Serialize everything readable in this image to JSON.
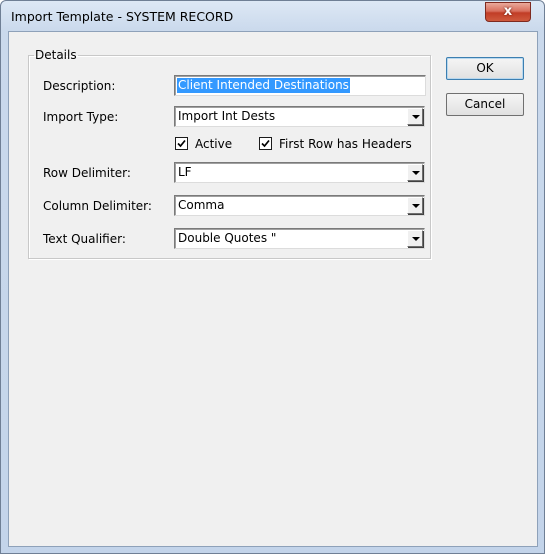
{
  "window": {
    "title": "Import Template - SYSTEM RECORD",
    "close_glyph": "x"
  },
  "group": {
    "legend": "Details"
  },
  "fields": {
    "description": {
      "label": "Description:",
      "value": "Client Intended Destinations"
    },
    "import_type": {
      "label": "Import Type:",
      "value": "Import Int Dests"
    },
    "active": {
      "label": "Active",
      "checked": true
    },
    "first_row_headers": {
      "label": "First Row has Headers",
      "checked": true
    },
    "row_delimiter": {
      "label": "Row Delimiter:",
      "value": "LF"
    },
    "column_delimiter": {
      "label": "Column Delimiter:",
      "value": "Comma"
    },
    "text_qualifier": {
      "label": "Text Qualifier:",
      "value": "Double Quotes \""
    }
  },
  "buttons": {
    "ok": "OK",
    "cancel": "Cancel"
  },
  "colors": {
    "selection": "#3399ff",
    "close_button": "#c13d26",
    "dialog_face": "#f0f0f0"
  },
  "icons": {
    "close": "close-icon",
    "dropdown": "chevron-down-icon",
    "checkbox": "checkmark-icon"
  }
}
